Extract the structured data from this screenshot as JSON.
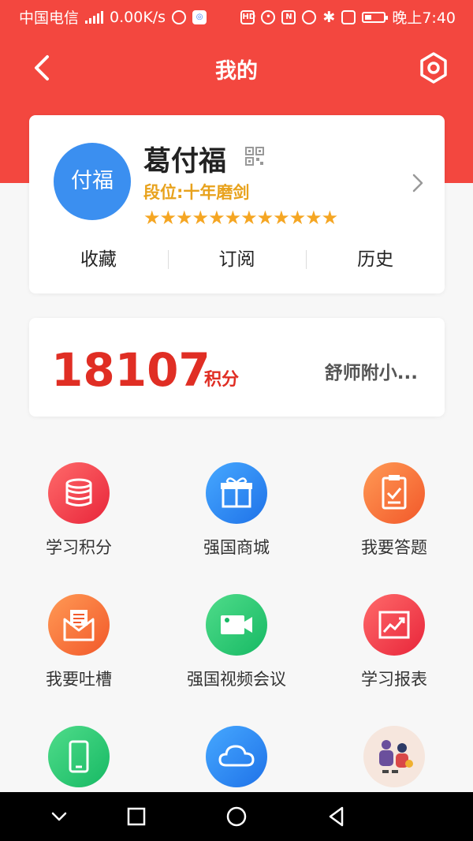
{
  "status_bar": {
    "carrier": "中国电信",
    "speed": "0.00K/s",
    "time": "晚上7:40"
  },
  "header": {
    "title": "我的"
  },
  "profile": {
    "avatar_text": "付福",
    "name": "葛付福",
    "rank": "段位:十年磨剑",
    "stars": "★★★★★★★★★★★★",
    "links": [
      "收藏",
      "订阅",
      "历史"
    ]
  },
  "points": {
    "value": "18107",
    "unit": "积分",
    "school": "舒师附小..."
  },
  "grid": {
    "items": [
      {
        "label": "学习积分",
        "icon": "database-icon"
      },
      {
        "label": "强国商城",
        "icon": "gift-icon"
      },
      {
        "label": "我要答题",
        "icon": "clipboard-check-icon"
      },
      {
        "label": "我要吐槽",
        "icon": "mail-open-icon"
      },
      {
        "label": "强国视频会议",
        "icon": "video-camera-icon"
      },
      {
        "label": "学习报表",
        "icon": "chart-icon"
      },
      {
        "label": "",
        "icon": "phone-icon"
      },
      {
        "label": "",
        "icon": "cloud-icon"
      },
      {
        "label": "",
        "icon": "illustration-icon"
      }
    ]
  },
  "colors": {
    "header_red": "#f3473f",
    "points_red": "#e02e24",
    "rank_gold": "#e8a21c",
    "star_gold": "#f5a623"
  }
}
